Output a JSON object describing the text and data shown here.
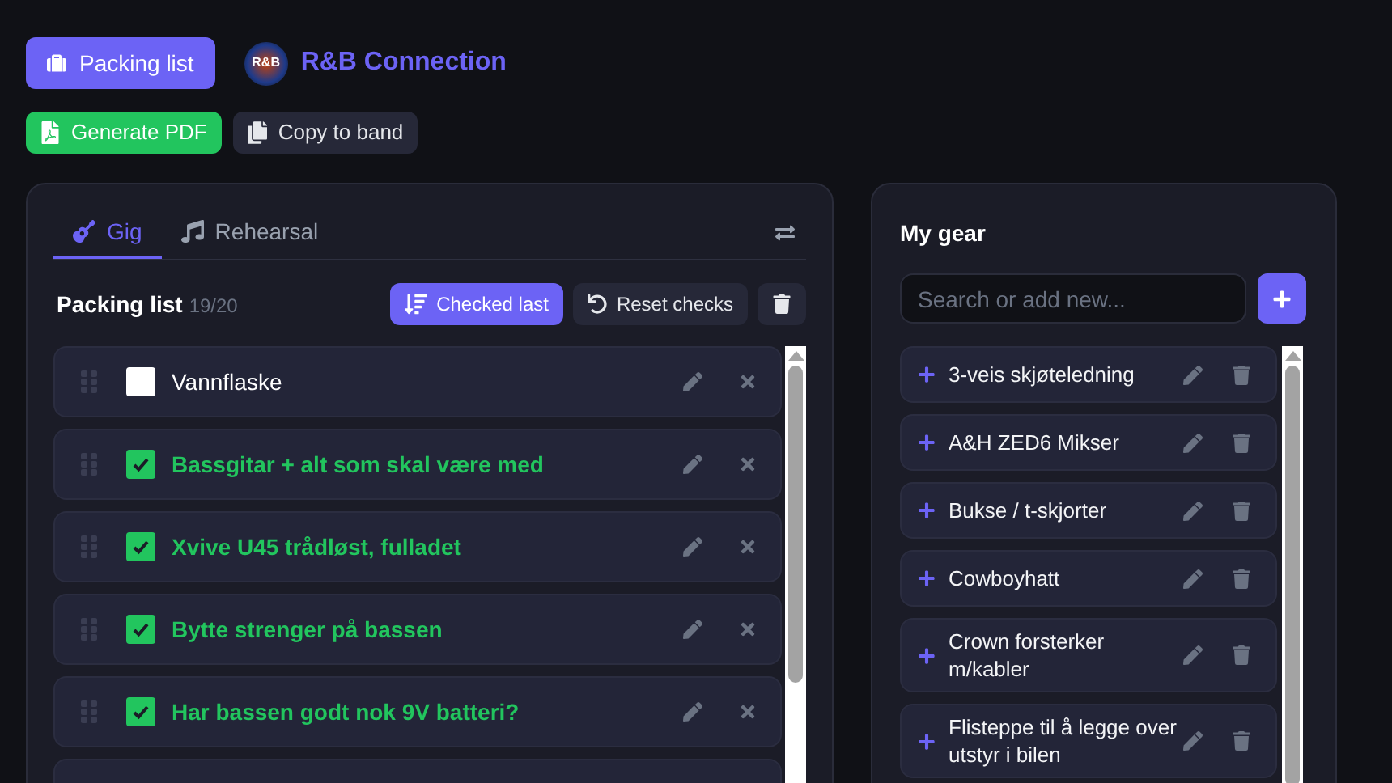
{
  "header": {
    "nav_button": {
      "label": "Packing list",
      "selected": true
    },
    "logo_text": "R&B",
    "band_name": "R&B Connection"
  },
  "actions": [
    {
      "kind": "pdf",
      "label": "Generate PDF"
    },
    {
      "kind": "copy",
      "label": "Copy to band"
    }
  ],
  "packing": {
    "tabs": [
      {
        "kind": "gig",
        "label": "Gig",
        "selected": true
      },
      {
        "kind": "rehearsal",
        "label": "Rehearsal",
        "selected": false
      }
    ],
    "title": "Packing list",
    "count": "19/20",
    "buttons": [
      {
        "kind": "sort",
        "label": "Checked last"
      },
      {
        "kind": "reset",
        "label": "Reset checks"
      }
    ],
    "items": [
      {
        "label": "Vannflaske",
        "checked": false
      },
      {
        "label": "Bassgitar + alt som skal være med",
        "checked": true
      },
      {
        "label": "Xvive U45 trådløst, fulladet",
        "checked": true
      },
      {
        "label": "Bytte strenger på bassen",
        "checked": true
      },
      {
        "label": "Har bassen godt nok 9V batteri?",
        "checked": true
      }
    ]
  },
  "gear": {
    "title": "My gear",
    "search": {
      "placeholder": "Search or add new..."
    },
    "items": [
      {
        "label": "3-veis skjøteledning"
      },
      {
        "label": "A&H ZED6 Mikser"
      },
      {
        "label": "Bukse / t-skjorter"
      },
      {
        "label": "Cowboyhatt"
      },
      {
        "label": "Crown forsterker m/kabler"
      },
      {
        "label": "Flisteppe til å legge over utstyr i bilen"
      }
    ]
  }
}
